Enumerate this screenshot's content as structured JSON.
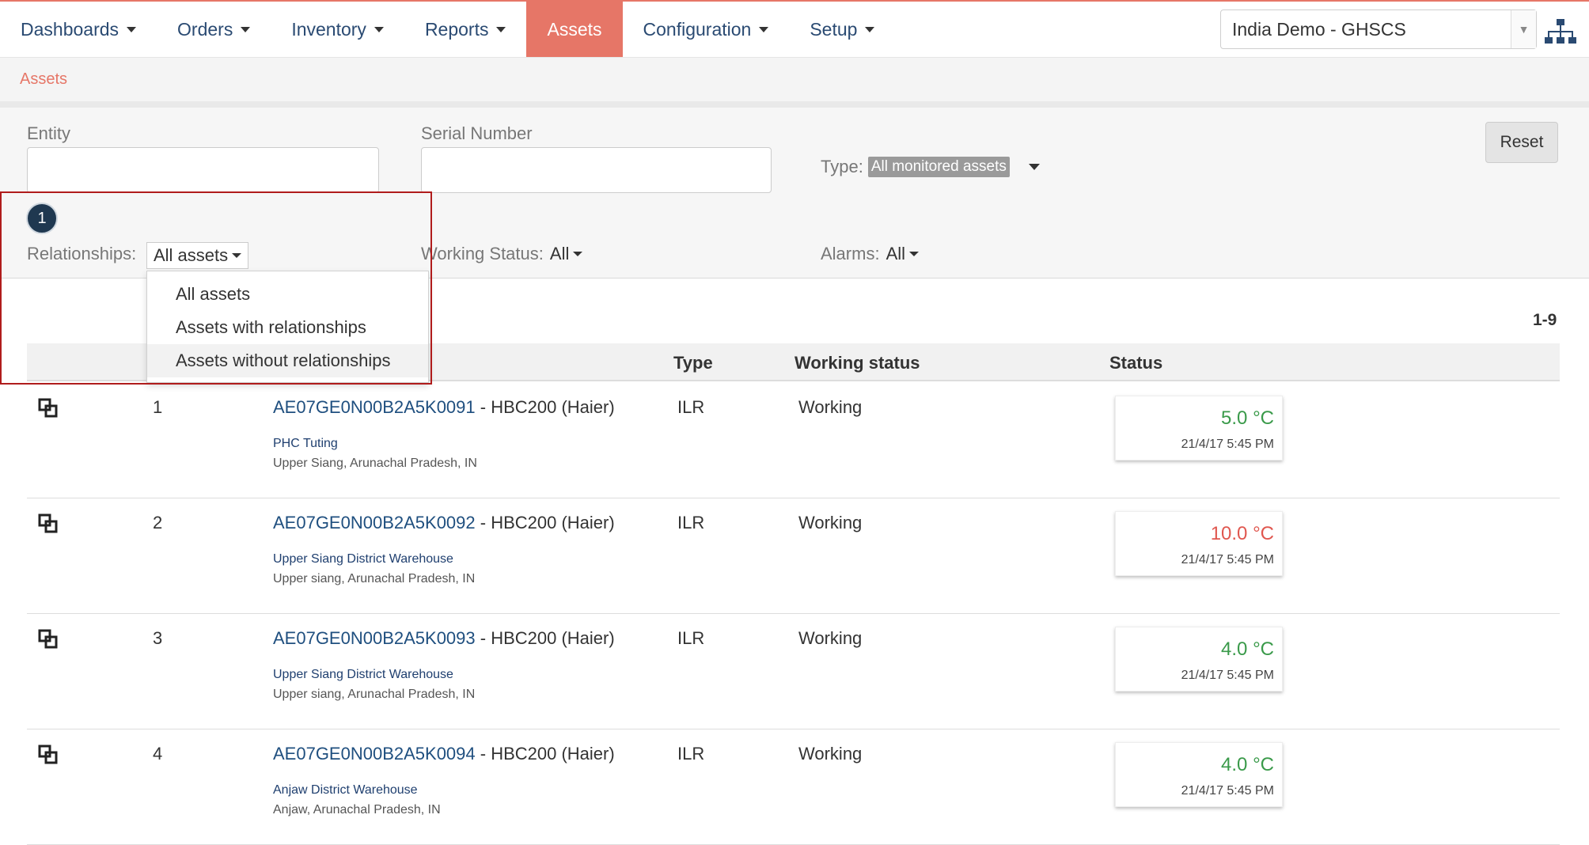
{
  "nav": {
    "items": [
      {
        "label": "Dashboards",
        "caret": true,
        "active": false
      },
      {
        "label": "Orders",
        "caret": true,
        "active": false
      },
      {
        "label": "Inventory",
        "caret": true,
        "active": false
      },
      {
        "label": "Reports",
        "caret": true,
        "active": false
      },
      {
        "label": "Assets",
        "caret": false,
        "active": true
      },
      {
        "label": "Configuration",
        "caret": true,
        "active": false
      },
      {
        "label": "Setup",
        "caret": true,
        "active": false
      }
    ],
    "domain_select": "India Demo - GHSCS",
    "hierarchy_icon": "hierarchy-icon"
  },
  "breadcrumb": "Assets",
  "filters": {
    "entity_label": "Entity",
    "entity_value": "",
    "serial_label": "Serial Number",
    "serial_value": "",
    "type_label": "Type:",
    "type_value": "All monitored assets",
    "reset_label": "Reset",
    "relationships_label": "Relationships:",
    "relationships_value": "All assets",
    "working_status_label": "Working Status:",
    "working_status_value": "All",
    "alarms_label": "Alarms:",
    "alarms_value": "All"
  },
  "relationship_menu": {
    "options": [
      "All assets",
      "Assets with relationships",
      "Assets without relationships"
    ],
    "highlighted": "Assets without relationships"
  },
  "callout_number": "1",
  "table": {
    "count": "1-9",
    "headers": {
      "type": "Type",
      "working_status": "Working status",
      "status": "Status"
    },
    "rows": [
      {
        "index": "1",
        "serial": "AE07GE0N00B2A5K0091",
        "model": " - HBC200 (Haier)",
        "entity": "PHC Tuting",
        "location": "Upper Siang, Arunachal Pradesh, IN",
        "type": "ILR",
        "working_status": "Working",
        "temperature": "5.0 °C",
        "temp_state": "normal",
        "time": "21/4/17 5:45 PM"
      },
      {
        "index": "2",
        "serial": "AE07GE0N00B2A5K0092",
        "model": " - HBC200 (Haier)",
        "entity": "Upper Siang District Warehouse",
        "location": "Upper siang, Arunachal Pradesh, IN",
        "type": "ILR",
        "working_status": "Working",
        "temperature": "10.0 °C",
        "temp_state": "alarm",
        "time": "21/4/17 5:45 PM"
      },
      {
        "index": "3",
        "serial": "AE07GE0N00B2A5K0093",
        "model": " - HBC200 (Haier)",
        "entity": "Upper Siang District Warehouse",
        "location": "Upper siang, Arunachal Pradesh, IN",
        "type": "ILR",
        "working_status": "Working",
        "temperature": "4.0 °C",
        "temp_state": "normal",
        "time": "21/4/17 5:45 PM"
      },
      {
        "index": "4",
        "serial": "AE07GE0N00B2A5K0094",
        "model": " - HBC200 (Haier)",
        "entity": "Anjaw District Warehouse",
        "location": "Anjaw, Arunachal Pradesh, IN",
        "type": "ILR",
        "working_status": "Working",
        "temperature": "4.0 °C",
        "temp_state": "normal",
        "time": "21/4/17 5:45 PM"
      }
    ]
  },
  "colors": {
    "accent": "#e67667",
    "link": "#1f4f7f",
    "temp_normal": "#3a9a4a",
    "temp_alarm": "#e0574f",
    "callout_border": "#b01c1c"
  }
}
